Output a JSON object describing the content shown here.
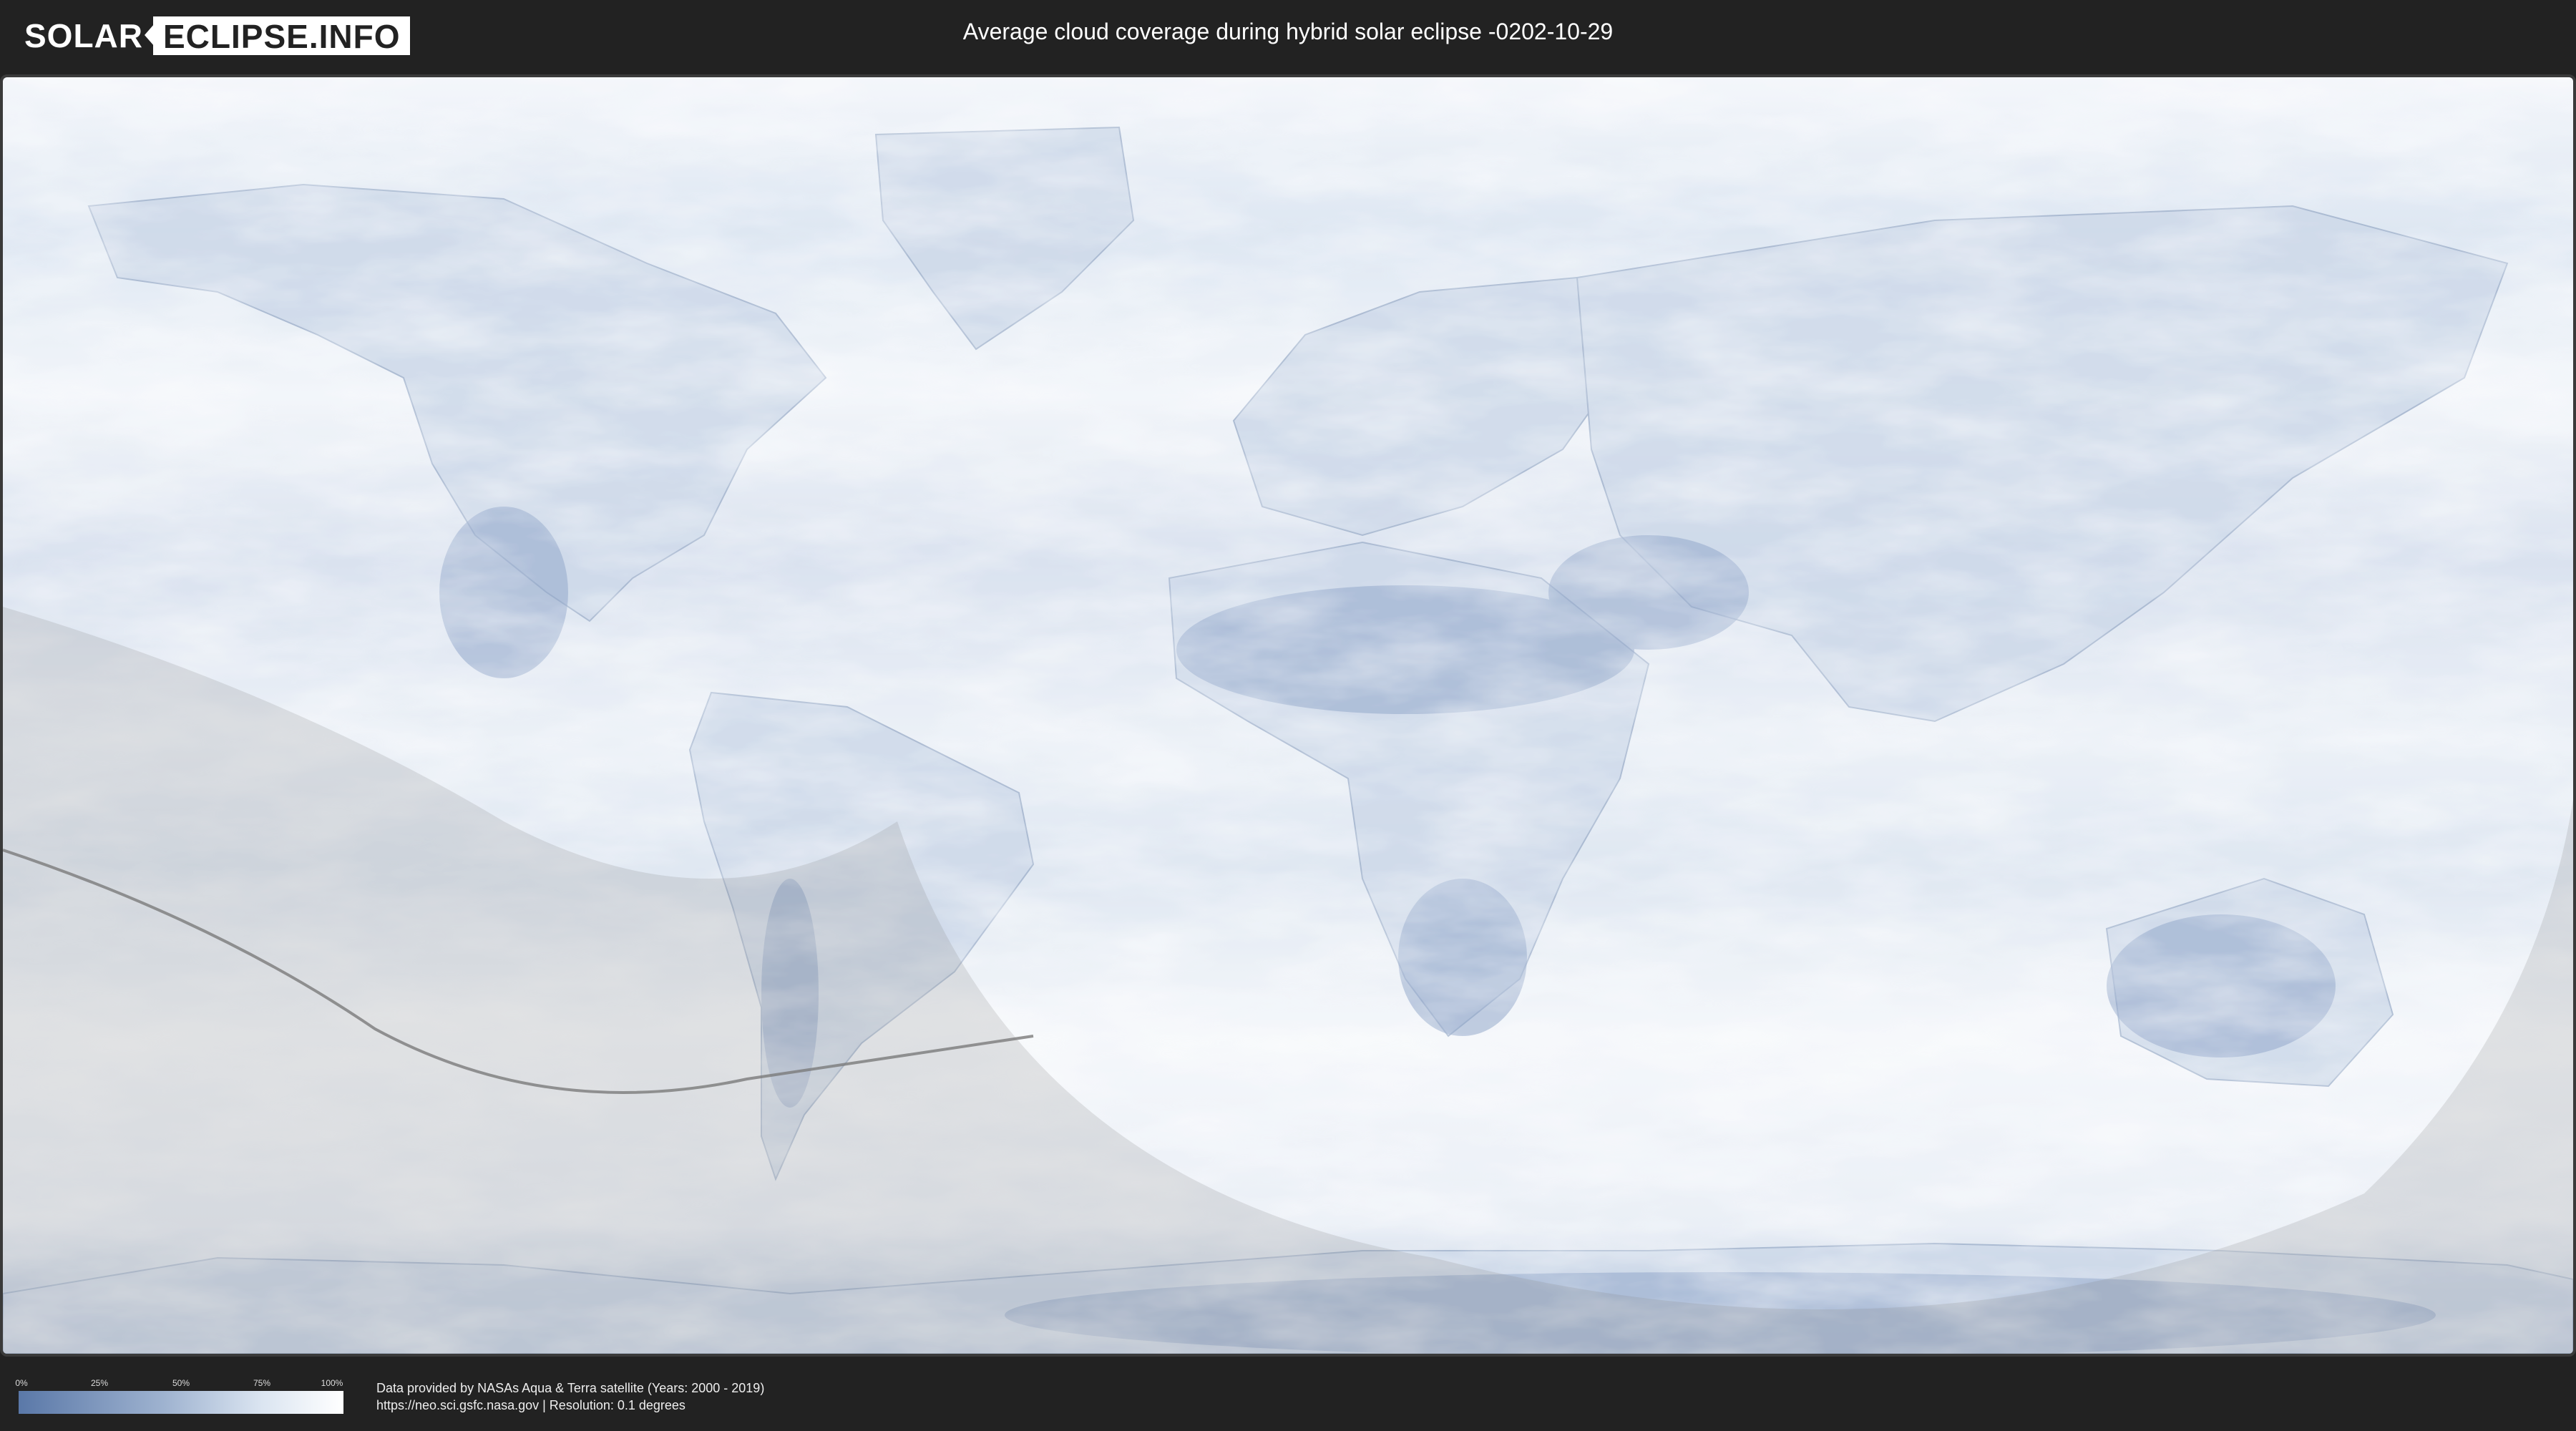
{
  "header": {
    "logo_left": "SOLAR",
    "logo_right": "ECLIPSE.INFO",
    "title": "Average cloud coverage during hybrid solar eclipse -0202-10-29"
  },
  "map": {
    "ocean_color": "#e4ecf6",
    "cloud_color": "#ffffff",
    "land_color": "#b9c9e0",
    "clear_sky_color": "#7c96bf",
    "shadow_color": "#c8c8c8",
    "eclipse_path_color": "#7a7a7a"
  },
  "legend": {
    "ticks": [
      "0%",
      "25%",
      "50%",
      "75%",
      "100%"
    ]
  },
  "footer": {
    "source_line1": "Data provided by NASAs Aqua & Terra satellite (Years: 2000 - 2019)",
    "source_line2": "https://neo.sci.gsfc.nasa.gov | Resolution: 0.1 degrees"
  }
}
